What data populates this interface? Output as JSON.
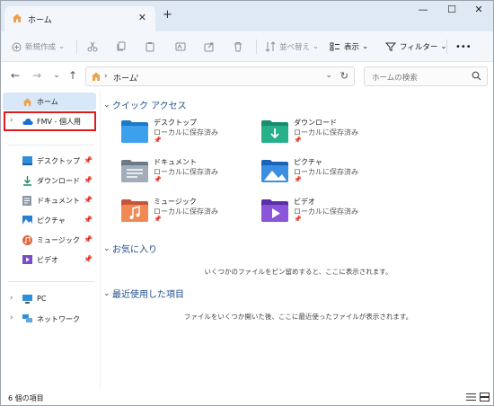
{
  "window": {
    "tab_title": "ホーム",
    "new_tab": "+",
    "tab_close": "✕",
    "controls": {
      "minimize": "—",
      "maximize": "☐",
      "close": "✕"
    }
  },
  "toolbar": {
    "new": "新規作成",
    "sort": "並べ替え",
    "view": "表示",
    "filter": "フィルター",
    "more": "•••"
  },
  "address": {
    "path": [
      "ホーム"
    ],
    "chevron": "›",
    "search_placeholder": "ホームの検索"
  },
  "sidebar": {
    "home": "ホーム",
    "onedrive": "FMV - 個人用",
    "quick": [
      {
        "label": "デスクトップ",
        "icon": "desktop-icon"
      },
      {
        "label": "ダウンロード",
        "icon": "download-icon"
      },
      {
        "label": "ドキュメント",
        "icon": "documents-icon"
      },
      {
        "label": "ピクチャ",
        "icon": "pictures-icon"
      },
      {
        "label": "ミュージック",
        "icon": "music-icon"
      },
      {
        "label": "ビデオ",
        "icon": "videos-icon"
      }
    ],
    "pc": "PC",
    "network": "ネットワーク"
  },
  "main": {
    "quick_access": {
      "title": "クイック アクセス",
      "items": [
        {
          "name": "デスクトップ",
          "sub": "ローカルに保存済み"
        },
        {
          "name": "ダウンロード",
          "sub": "ローカルに保存済み"
        },
        {
          "name": "ドキュメント",
          "sub": "ローカルに保存済み"
        },
        {
          "name": "ピクチャ",
          "sub": "ローカルに保存済み"
        },
        {
          "name": "ミュージック",
          "sub": "ローカルに保存済み"
        },
        {
          "name": "ビデオ",
          "sub": "ローカルに保存済み"
        }
      ]
    },
    "favorites": {
      "title": "お気に入り",
      "message": "いくつかのファイルをピン留めすると、ここに表示されます。"
    },
    "recent": {
      "title": "最近使用した項目",
      "message": "ファイルをいくつか開いた後、ここに最近使ったファイルが表示されます。"
    }
  },
  "status": {
    "count": "6 個の項目"
  },
  "colors": {
    "accent": "#1f4e8c",
    "selection": "#d8e8f8",
    "highlight_box": "#e01b1b"
  }
}
